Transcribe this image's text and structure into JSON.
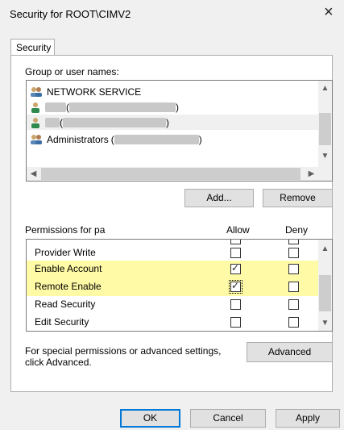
{
  "window": {
    "title": "Security for ROOT\\CIMV2",
    "close": "×"
  },
  "tabs": [
    {
      "label": "Security"
    }
  ],
  "groups": {
    "label": "Group or user names:",
    "items": [
      {
        "name": "NETWORK SERVICE",
        "suffix": "",
        "redacted": false
      },
      {
        "name": "",
        "suffix": "(",
        "close": ")",
        "redacted": true
      },
      {
        "name": "",
        "suffix": "(",
        "close": ")",
        "redacted": true
      },
      {
        "name": "Administrators",
        "suffix": "(",
        "close": ")",
        "redacted": true
      }
    ]
  },
  "buttons": {
    "add": "Add...",
    "remove": "Remove",
    "advanced": "Advanced",
    "ok": "OK",
    "cancel": "Cancel",
    "apply": "Apply"
  },
  "permissions": {
    "label": "Permissions for pa",
    "allow_header": "Allow",
    "deny_header": "Deny",
    "rows": [
      {
        "name": "Provider Write",
        "allow": false,
        "deny": false,
        "highlight": false
      },
      {
        "name": "Enable Account",
        "allow": true,
        "deny": false,
        "highlight": true
      },
      {
        "name": "Remote Enable",
        "allow": true,
        "deny": false,
        "highlight": true
      },
      {
        "name": "Read Security",
        "allow": false,
        "deny": false,
        "highlight": false
      },
      {
        "name": "Edit Security",
        "allow": false,
        "deny": false,
        "highlight": false
      }
    ]
  },
  "advanced_text": {
    "line1": "For special permissions or advanced settings,",
    "line2": "click Advanced."
  }
}
